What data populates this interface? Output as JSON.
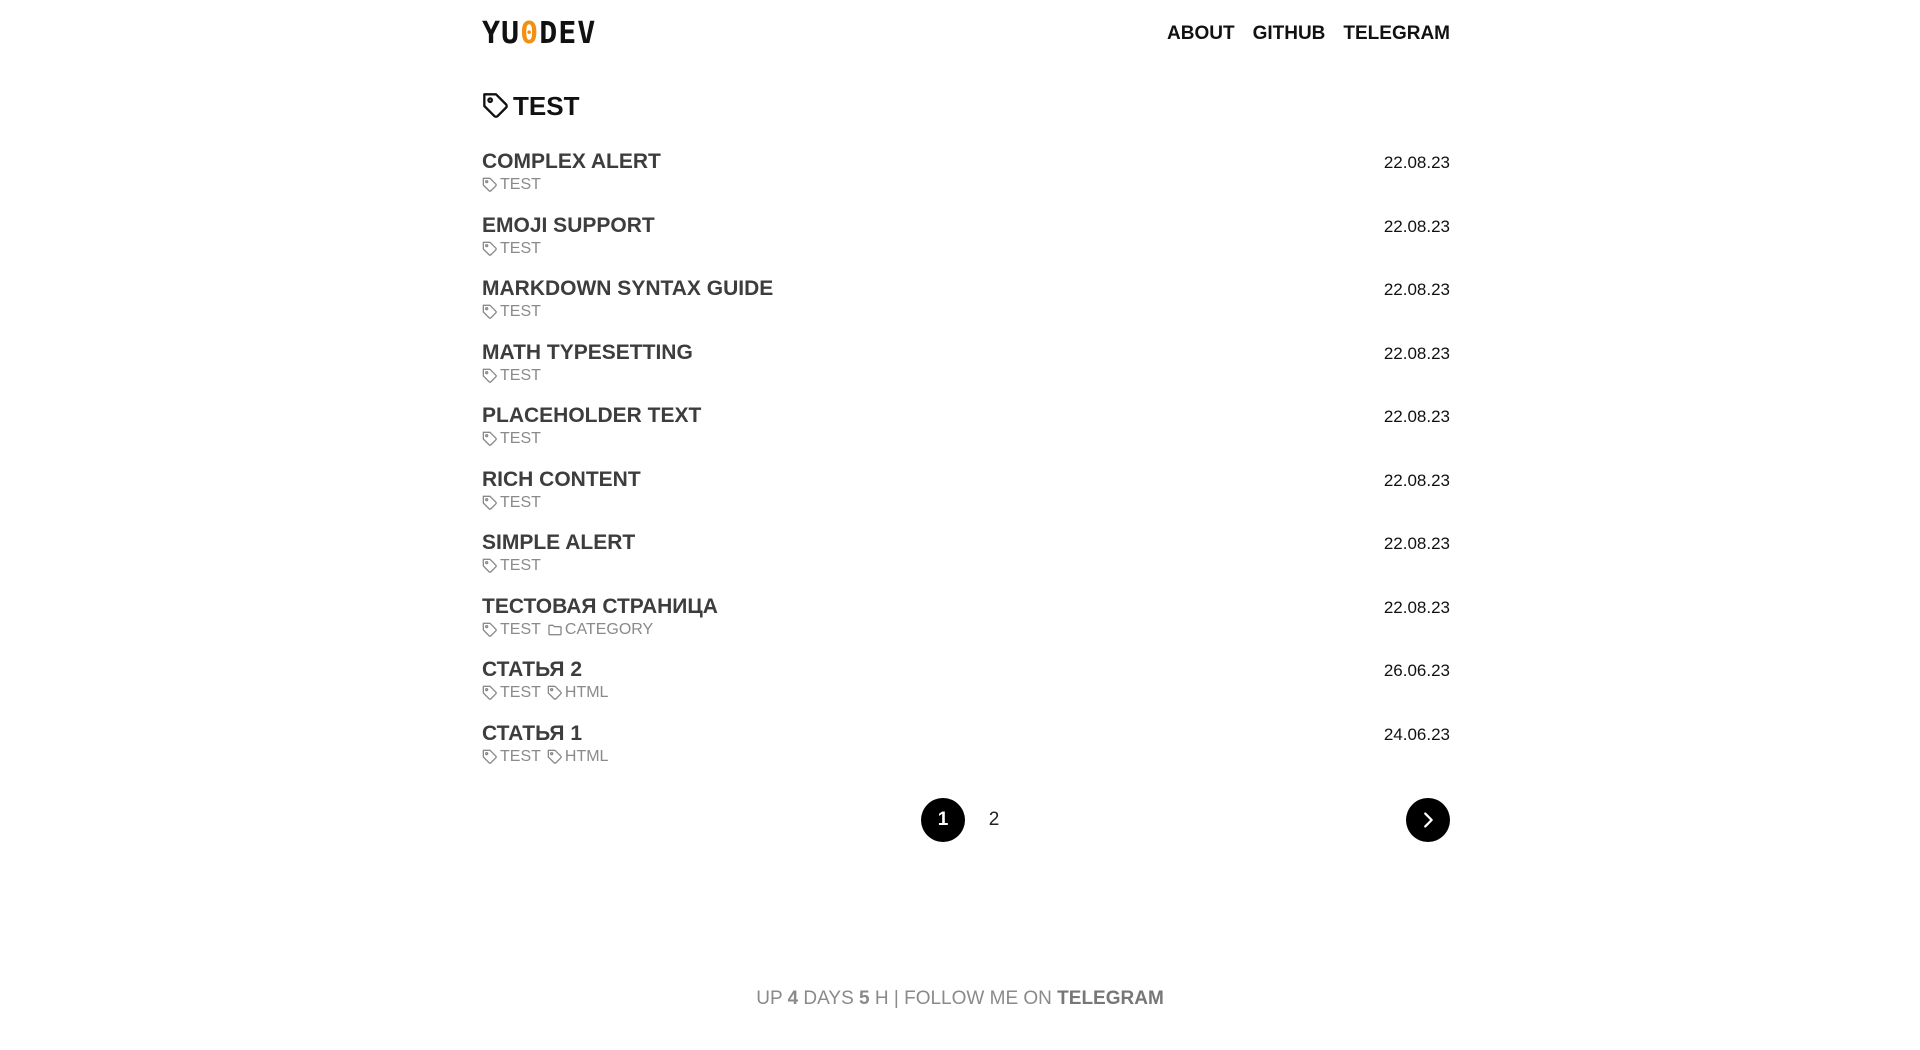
{
  "header": {
    "logo_left": "YU",
    "logo_mid": "0",
    "logo_right": "DEV",
    "nav": [
      {
        "label": "ABOUT"
      },
      {
        "label": "GITHUB"
      },
      {
        "label": "TELEGRAM"
      }
    ]
  },
  "page": {
    "title": "TEST",
    "icon": "tag-icon"
  },
  "posts": [
    {
      "title": "COMPLEX ALERT",
      "date": "22.08.23",
      "meta": [
        {
          "type": "tag",
          "label": "TEST"
        }
      ]
    },
    {
      "title": "EMOJI SUPPORT",
      "date": "22.08.23",
      "meta": [
        {
          "type": "tag",
          "label": "TEST"
        }
      ]
    },
    {
      "title": "MARKDOWN SYNTAX GUIDE",
      "date": "22.08.23",
      "meta": [
        {
          "type": "tag",
          "label": "TEST"
        }
      ]
    },
    {
      "title": "MATH TYPESETTING",
      "date": "22.08.23",
      "meta": [
        {
          "type": "tag",
          "label": "TEST"
        }
      ]
    },
    {
      "title": "PLACEHOLDER TEXT",
      "date": "22.08.23",
      "meta": [
        {
          "type": "tag",
          "label": "TEST"
        }
      ]
    },
    {
      "title": "RICH CONTENT",
      "date": "22.08.23",
      "meta": [
        {
          "type": "tag",
          "label": "TEST"
        }
      ]
    },
    {
      "title": "SIMPLE ALERT",
      "date": "22.08.23",
      "meta": [
        {
          "type": "tag",
          "label": "TEST"
        }
      ]
    },
    {
      "title": "ТЕСТОВАЯ СТРАНИЦА",
      "date": "22.08.23",
      "meta": [
        {
          "type": "tag",
          "label": "TEST"
        },
        {
          "type": "category",
          "label": "CATEGORY"
        }
      ]
    },
    {
      "title": "СТАТЬЯ 2",
      "date": "26.06.23",
      "meta": [
        {
          "type": "tag",
          "label": "TEST"
        },
        {
          "type": "tag",
          "label": "HTML"
        }
      ]
    },
    {
      "title": "СТАТЬЯ 1",
      "date": "24.06.23",
      "meta": [
        {
          "type": "tag",
          "label": "TEST"
        },
        {
          "type": "tag",
          "label": "HTML"
        }
      ]
    }
  ],
  "pagination": {
    "current": "1",
    "other": "2",
    "next_icon": "chevron-right-icon"
  },
  "footer": {
    "prefix": "UP ",
    "days_num": "4",
    "days_label": " DAYS ",
    "hours_num": "5",
    "hours_label": " H",
    "separator": " | FOLLOW ME ON ",
    "link": "TELEGRAM"
  },
  "colors": {
    "logo_accent": "#f29111",
    "text": "#111111",
    "muted": "#8a8a8a"
  }
}
